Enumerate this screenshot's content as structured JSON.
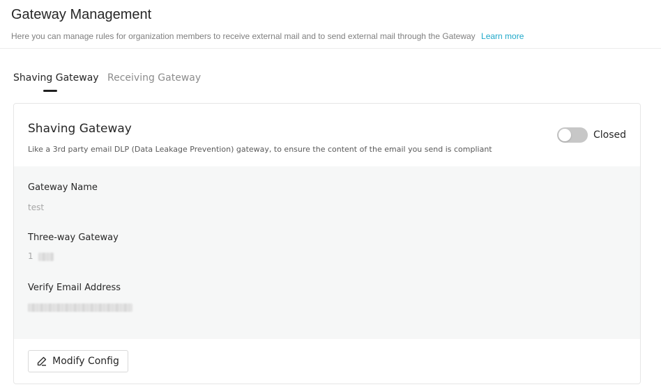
{
  "header": {
    "title": "Gateway Management",
    "subtitle": "Here you can manage rules for organization members to receive external mail and to send external mail through the Gateway",
    "learn_more": "Learn more"
  },
  "tabs": [
    {
      "label": "Shaving Gateway",
      "active": true
    },
    {
      "label": "Receiving Gateway",
      "active": false
    }
  ],
  "card": {
    "title": "Shaving Gateway",
    "description": "Like a 3rd party email DLP (Data Leakage Prevention) gateway, to ensure the content of the email you send is compliant",
    "toggle": {
      "state": "off",
      "label": "Closed"
    },
    "fields": [
      {
        "label": "Gateway Name",
        "value": "test"
      },
      {
        "label": "Three-way Gateway",
        "value": "1"
      },
      {
        "label": "Verify Email Address",
        "value": ""
      }
    ],
    "modify_button": "Modify Config"
  },
  "colors": {
    "accent_link": "#1fa8c9",
    "toggle_off": "#c7c7c7",
    "panel_bg": "#f6f7f7"
  },
  "icons": {
    "modify_button_icon": "edit-pencil-icon"
  }
}
